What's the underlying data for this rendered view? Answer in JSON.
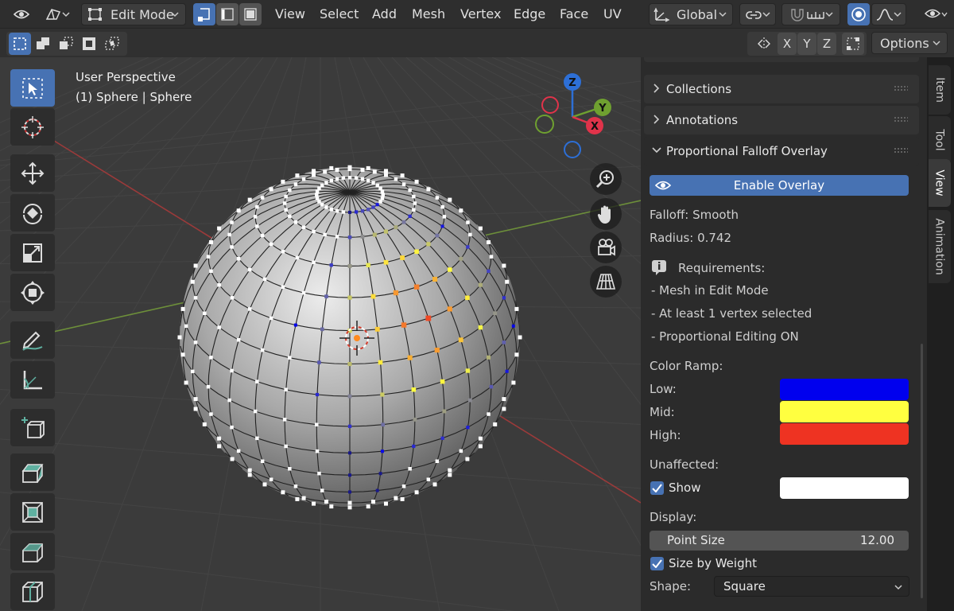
{
  "header": {
    "mode": "Edit Mode",
    "menus": [
      "View",
      "Select",
      "Add",
      "Mesh",
      "Vertex",
      "Edge",
      "Face",
      "UV"
    ],
    "orientation": "Global",
    "axes": [
      "X",
      "Y",
      "Z"
    ],
    "options_label": "Options"
  },
  "viewport": {
    "view_name": "User Perspective",
    "object_info": "(1) Sphere | Sphere",
    "gizmo": {
      "z": "Z",
      "y": "Y",
      "x": "X"
    }
  },
  "npanel": {
    "sections": {
      "collections": "Collections",
      "annotations": "Annotations",
      "falloff_overlay": "Proportional Falloff Overlay"
    },
    "enable_button": "Enable Overlay",
    "falloff": "Falloff: Smooth",
    "radius": "Radius: 0.742",
    "requirements_title": "Requirements:",
    "requirements": [
      "- Mesh in Edit Mode",
      "- At least 1 vertex selected",
      "- Proportional Editing ON"
    ],
    "color_ramp_title": "Color Ramp:",
    "ramp": {
      "low_label": "Low:",
      "mid_label": "Mid:",
      "high_label": "High:"
    },
    "colors": {
      "low": "#0000ee",
      "mid": "#ffff40",
      "high": "#ee3322",
      "unaffected": "#ffffff",
      "accent": "#4772b3"
    },
    "unaffected_title": "Unaffected:",
    "show_label": "Show",
    "display_title": "Display:",
    "point_size_label": "Point Size",
    "point_size_value": "12.00",
    "size_by_weight_label": "Size by Weight",
    "shape_label": "Shape:",
    "shape_value": "Square"
  },
  "tabs": [
    "Item",
    "Tool",
    "View",
    "Animation"
  ]
}
